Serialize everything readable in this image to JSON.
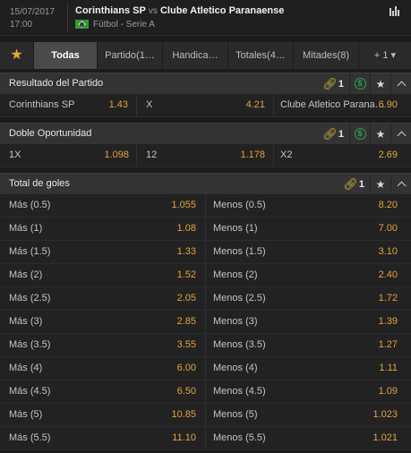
{
  "header": {
    "date": "15/07/2017",
    "time": "17:00",
    "home_team": "Corinthians SP",
    "vs": "vs",
    "away_team": "Clube Atletico Paranaense",
    "competition": "Fútbol - Serie A",
    "flag": "brazil-flag",
    "stats_icon": "bar-chart-icon"
  },
  "tabs": [
    {
      "label": "★",
      "icon": "star-icon"
    },
    {
      "label": "Todas"
    },
    {
      "label": "Partido(1…"
    },
    {
      "label": "Handica…"
    },
    {
      "label": "Totales(4…"
    },
    {
      "label": "Mitades(8)"
    },
    {
      "label": "+ 1 ▾"
    }
  ],
  "colors": {
    "accent": "#e9a834",
    "odds": "#e3a33a",
    "dollar": "#2f9e4e",
    "link": "#d2b63a"
  },
  "markets": {
    "resultado": {
      "title": "Resultado del Partido",
      "link_count": "1",
      "row": [
        {
          "label": "Corinthians SP",
          "odd": "1.43"
        },
        {
          "label": "X",
          "odd": "4.21"
        },
        {
          "label": "Clube Atletico Parana…",
          "odd": "6.90"
        }
      ]
    },
    "doble": {
      "title": "Doble Oportunidad",
      "link_count": "1",
      "row": [
        {
          "label": "1X",
          "odd": "1.098"
        },
        {
          "label": "12",
          "odd": "1.178"
        },
        {
          "label": "X2",
          "odd": "2.69"
        }
      ]
    },
    "goles": {
      "title": "Total de goles",
      "link_count": "1",
      "rows": [
        {
          "over": "Más (0.5)",
          "over_odd": "1.055",
          "under": "Menos (0.5)",
          "under_odd": "8.20"
        },
        {
          "over": "Más (1)",
          "over_odd": "1.08",
          "under": "Menos (1)",
          "under_odd": "7.00"
        },
        {
          "over": "Más (1.5)",
          "over_odd": "1.33",
          "under": "Menos (1.5)",
          "under_odd": "3.10"
        },
        {
          "over": "Más (2)",
          "over_odd": "1.52",
          "under": "Menos (2)",
          "under_odd": "2.40"
        },
        {
          "over": "Más (2.5)",
          "over_odd": "2.05",
          "under": "Menos (2.5)",
          "under_odd": "1.72"
        },
        {
          "over": "Más (3)",
          "over_odd": "2.85",
          "under": "Menos (3)",
          "under_odd": "1.39"
        },
        {
          "over": "Más (3.5)",
          "over_odd": "3.55",
          "under": "Menos (3.5)",
          "under_odd": "1.27"
        },
        {
          "over": "Más (4)",
          "over_odd": "6.00",
          "under": "Menos (4)",
          "under_odd": "1.11"
        },
        {
          "over": "Más (4.5)",
          "over_odd": "6.50",
          "under": "Menos (4.5)",
          "under_odd": "1.09"
        },
        {
          "over": "Más (5)",
          "over_odd": "10.85",
          "under": "Menos (5)",
          "under_odd": "1.023"
        },
        {
          "over": "Más (5.5)",
          "over_odd": "11.10",
          "under": "Menos (5.5)",
          "under_odd": "1.021"
        }
      ]
    }
  }
}
